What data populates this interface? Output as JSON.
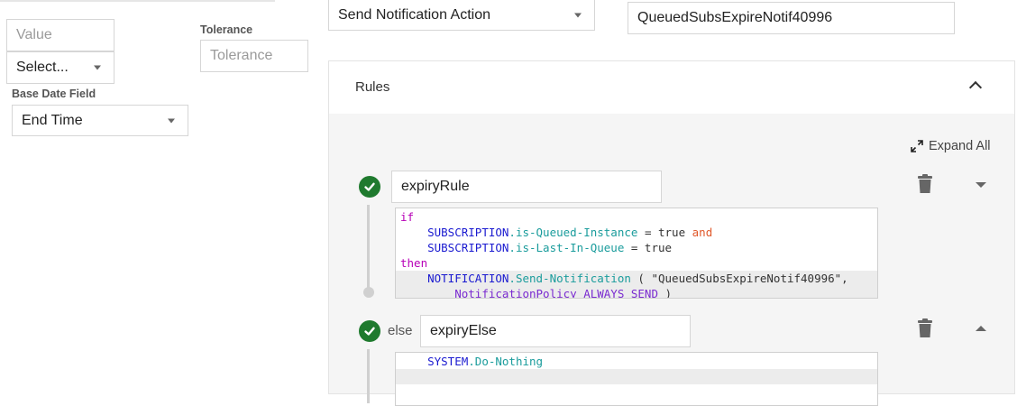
{
  "left_form": {
    "value_placeholder": "Value",
    "select_placeholder": "Select...",
    "tolerance_label": "Tolerance",
    "tolerance_placeholder": "Tolerance",
    "base_date_label": "Base Date Field",
    "base_date_value": "End Time"
  },
  "top": {
    "action_select": "Send Notification Action",
    "name_value": "QueuedSubsExpireNotif40996"
  },
  "rules_panel": {
    "title": "Rules",
    "expand_all": "Expand All",
    "rule": {
      "name": "expiryRule",
      "code": {
        "if": "if",
        "obj1": "SUBSCRIPTION",
        "prop1": ".is-Queued-Instance",
        "eq1": " = true ",
        "and": "and",
        "obj2": "SUBSCRIPTION",
        "prop2": ".is-Last-In-Queue",
        "eq2": " = true",
        "then": "then",
        "obj3": "NOTIFICATION",
        "prop3": ".Send-Notification",
        "args": " ( \"QueuedSubsExpireNotif40996\",",
        "policy": "NotificationPolicy ALWAYS SEND",
        "close": " )"
      }
    },
    "else_rule": {
      "label": "else",
      "name": "expiryElse",
      "code": {
        "obj": "SYSTEM",
        "prop": ".Do-Nothing"
      }
    }
  },
  "colors": {
    "check_green": "#1f7a2e",
    "keyword": "#b700b7",
    "object": "#1a1ad0",
    "property": "#1a9c9c",
    "operator": "#e0582a"
  }
}
